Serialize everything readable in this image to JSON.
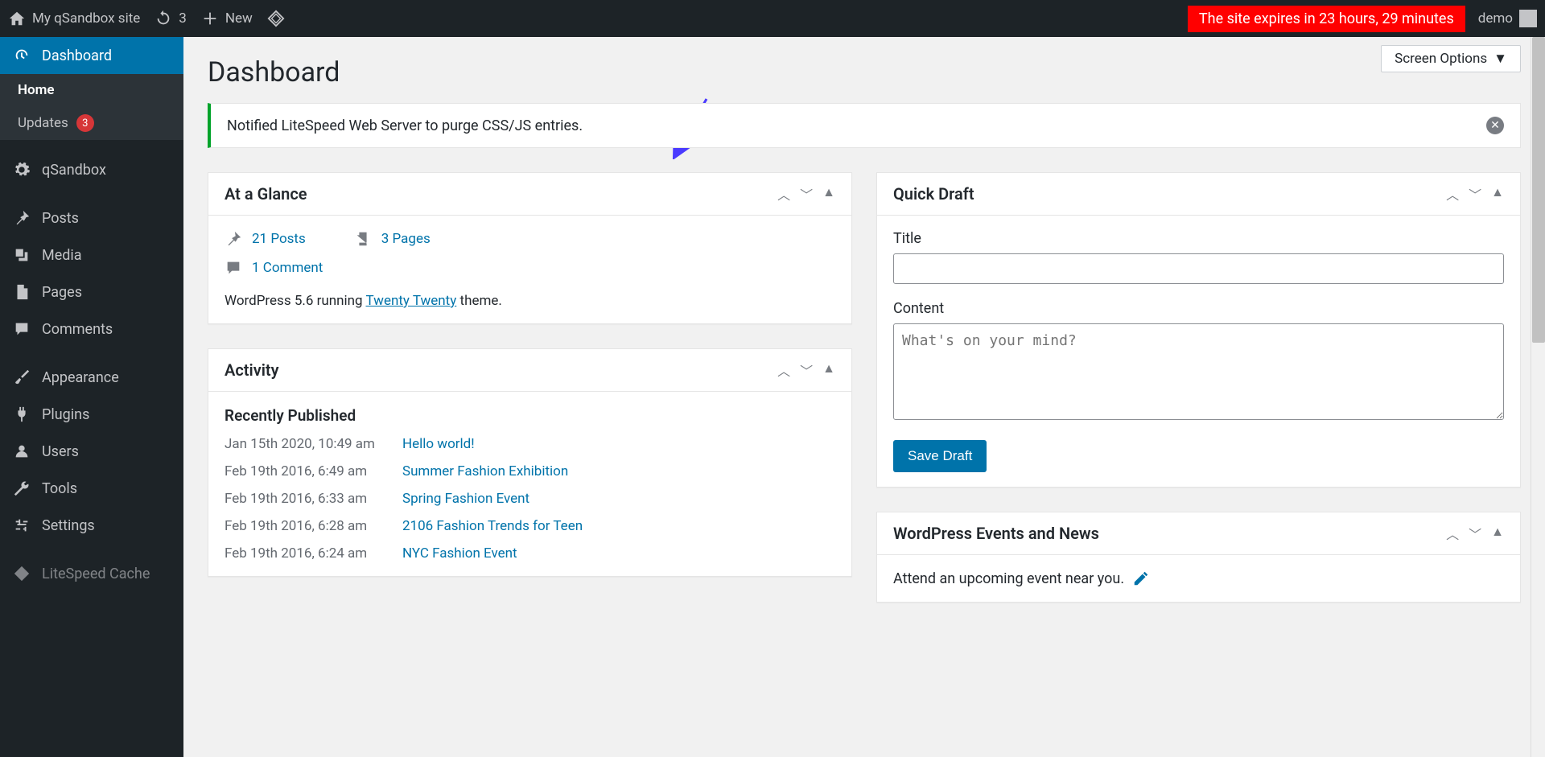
{
  "adminbar": {
    "site_name": "My qSandbox site",
    "updates_count": "3",
    "new_label": "New",
    "expire_text": "The site expires in  23 hours, 29 minutes",
    "user_name": "demo"
  },
  "sidebar": {
    "dashboard": "Dashboard",
    "home": "Home",
    "updates": "Updates",
    "updates_badge": "3",
    "qsandbox": "qSandbox",
    "posts": "Posts",
    "media": "Media",
    "pages": "Pages",
    "comments": "Comments",
    "appearance": "Appearance",
    "plugins": "Plugins",
    "users": "Users",
    "tools": "Tools",
    "settings": "Settings",
    "litespeed": "LiteSpeed Cache"
  },
  "screen_options": "Screen Options",
  "page_title": "Dashboard",
  "notice": "Notified LiteSpeed Web Server to purge CSS/JS entries.",
  "glance": {
    "title": "At a Glance",
    "posts": "21 Posts",
    "pages": "3 Pages",
    "comments": "1 Comment",
    "running_pre": "WordPress 5.6 running ",
    "theme": "Twenty Twenty",
    "running_post": " theme."
  },
  "activity": {
    "title": "Activity",
    "section": "Recently Published",
    "items": [
      {
        "date": "Jan 15th 2020, 10:49 am",
        "title": "Hello world!"
      },
      {
        "date": "Feb 19th 2016, 6:49 am",
        "title": "Summer Fashion Exhibition"
      },
      {
        "date": "Feb 19th 2016, 6:33 am",
        "title": "Spring Fashion Event"
      },
      {
        "date": "Feb 19th 2016, 6:28 am",
        "title": "2106 Fashion Trends for Teen"
      },
      {
        "date": "Feb 19th 2016, 6:24 am",
        "title": "NYC Fashion Event"
      }
    ]
  },
  "quickdraft": {
    "title": "Quick Draft",
    "title_label": "Title",
    "content_label": "Content",
    "content_placeholder": "What's on your mind?",
    "save_button": "Save Draft"
  },
  "events": {
    "title": "WordPress Events and News",
    "text": "Attend an upcoming event near you."
  }
}
